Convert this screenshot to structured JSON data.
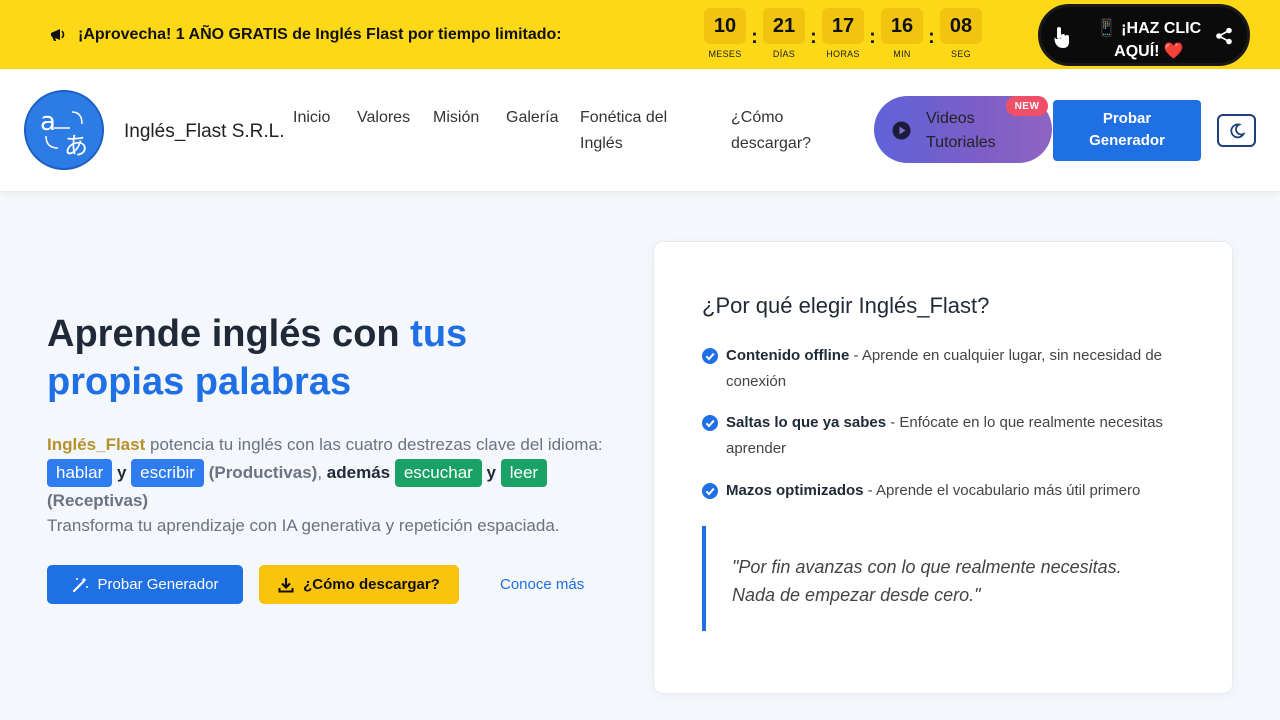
{
  "promo": {
    "text": "¡Aprovecha! 1 AÑO GRATIS de Inglés Flast por tiempo limitado:",
    "countdown": [
      {
        "value": "10",
        "label": "MESES"
      },
      {
        "value": "21",
        "label": "DÍAS"
      },
      {
        "value": "17",
        "label": "HORAS"
      },
      {
        "value": "16",
        "label": "MIN"
      },
      {
        "value": "08",
        "label": "SEG"
      }
    ],
    "separator": ":",
    "cta_line1": "📱 ¡HAZ CLIC",
    "cta_line2": "AQUÍ! ❤️"
  },
  "nav": {
    "brand": "Inglés_Flast S.R.L.",
    "links": [
      "Inicio",
      "Valores",
      "Misión",
      "Galería",
      "Fonética del Inglés",
      "¿Cómo descargar?"
    ],
    "videos_label": "Videos Tutoriales",
    "new_badge": "NEW",
    "probar_label": "Probar Generador"
  },
  "hero": {
    "title_part1": "Aprende inglés con ",
    "title_accent": "tus propias palabras",
    "desc_brand": "Inglés_Flast",
    "desc_text": " potencia tu inglés con las cuatro destrezas clave del idioma: ",
    "pill_hablar": "hablar",
    "y1": " y ",
    "pill_escribir": "escribir",
    "productivas": " (Productivas)",
    "comma": ", ",
    "ademas": "además",
    "pill_escuchar": "escuchar",
    "y2": " y ",
    "pill_leer": "leer",
    "receptivas": "(Receptivas)",
    "transform": "Transforma tu aprendizaje con IA generativa y repetición espaciada.",
    "btn_probar": "Probar Generador",
    "btn_descargar": "¿Cómo descargar?",
    "link_more": "Conoce más"
  },
  "card": {
    "title": "¿Por qué elegir Inglés_Flast?",
    "features": [
      {
        "bold": "Contenido offline",
        "text": " - Aprende en cualquier lugar, sin necesidad de conexión"
      },
      {
        "bold": "Saltas lo que ya sabes",
        "text": " - Enfócate en lo que realmente necesitas aprender"
      },
      {
        "bold": "Mazos optimizados",
        "text": " - Aprende el vocabulario más útil primero"
      }
    ],
    "quote": "\"Por fin avanzas con lo que realmente necesitas. Nada de empezar desde cero.\""
  },
  "colors": {
    "promo_bg": "#fdd816",
    "primary": "#1f6fe5",
    "accent_yellow": "#fbc40c",
    "green": "#1aa266",
    "badge_red": "#f05067"
  },
  "icons": {
    "promo": "megaphone-icon",
    "cta_hand": "pointer-hand-icon",
    "cta_share": "share-icon",
    "logo": "translate-icon",
    "videos": "play-circle-icon",
    "theme": "moon-icon",
    "probar": "magic-wand-icon",
    "descargar": "download-icon",
    "check": "check-circle-icon"
  }
}
